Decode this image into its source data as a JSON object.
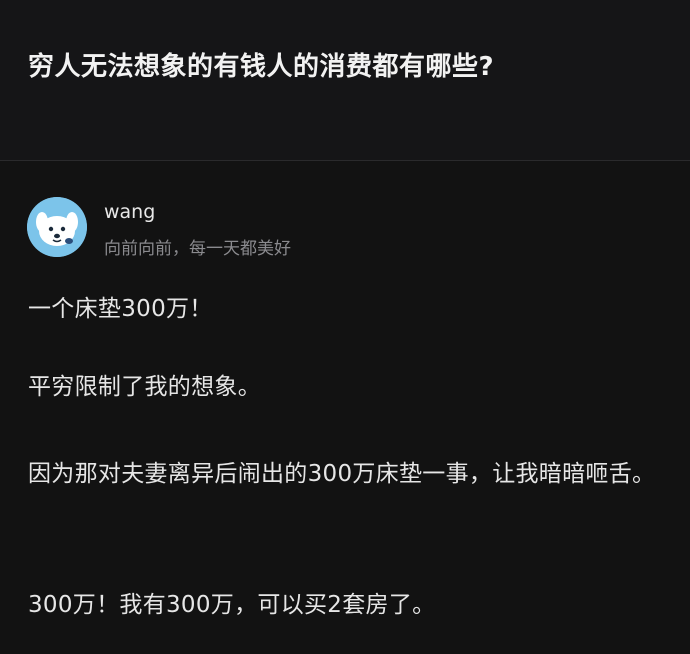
{
  "question": {
    "title": "穷人无法想象的有钱人的消费都有哪些?"
  },
  "answer": {
    "author": {
      "name": "wang",
      "bio": "向前向前，每一天都美好",
      "avatar_icon": "cartoon-dog-avatar"
    },
    "paragraphs": [
      "一个床垫300万！",
      "平穷限制了我的想象。",
      "因为那对夫妻离异后闹出的300万床垫一事，让我暗暗咂舌。",
      "300万！我有300万，可以买2套房了。"
    ]
  },
  "colors": {
    "background": "#121212",
    "header_background": "#151517",
    "text_primary": "#e6e6e6",
    "text_secondary": "#8a8a8e",
    "avatar_background": "#7cc4ea"
  }
}
